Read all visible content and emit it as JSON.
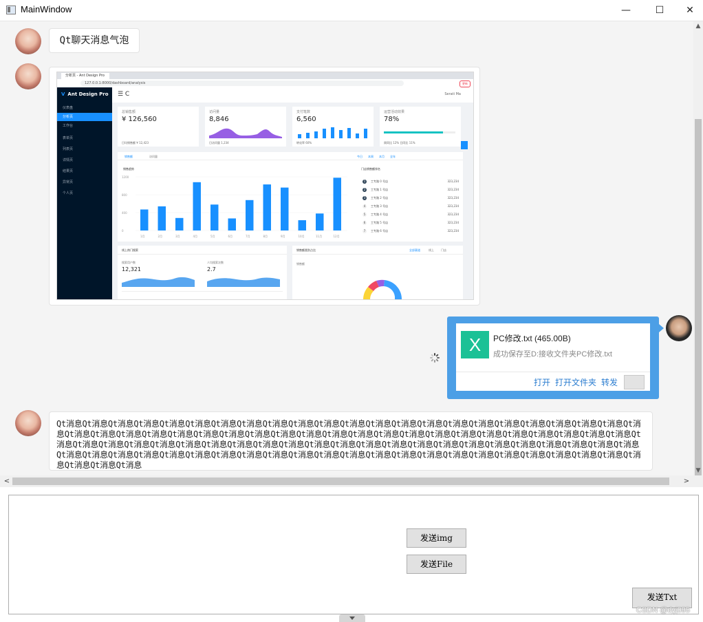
{
  "window": {
    "title": "MainWindow",
    "min": "—",
    "max": "☐",
    "close": "✕"
  },
  "messages": {
    "first_text": "Qt聊天消息气泡",
    "long_text": "Qt消息Qt消息Qt消息Qt消息Qt消息Qt消息Qt消息Qt消息Qt消息Qt消息Qt消息Qt消息Qt消息Qt消息Qt消息Qt消息Qt消息Qt消息Qt消息Qt消息Qt消息Qt消息Qt消息Qt消息Qt消息Qt消息Qt消息Qt消息Qt消息Qt消息Qt消息Qt消息Qt消息Qt消息Qt消息Qt消息Qt消息Qt消息Qt消息Qt消息Qt消息Qt消息Qt消息Qt消息Qt消息Qt消息Qt消息Qt消息Qt消息Qt消息Qt消息Qt消息Qt消息Qt消息Qt消息Qt消息Qt消息Qt消息Qt消息Qt消息Qt消息Qt消息Qt消息Qt消息Qt消息Qt消息Qt消息Qt消息Qt消息Qt消息Qt消息Qt消息Qt消息Qt消息Qt消息Qt消息Qt消息Qt消息Qt消息Qt消息Qt消息Qt消息Qt消息Qt消息Qt消息Qt消息Qt消息Qt消息Qt消息Qt消息Qt消息Qt消息Qt消息Qt消息"
  },
  "file_message": {
    "icon_letter": "X",
    "name": "PC修改.txt (465.00B)",
    "status": "成功保存至D:接收文件夹PC修改.txt",
    "open": "打开",
    "open_folder": "打开文件夹",
    "forward": "转发"
  },
  "screenshot": {
    "tab": "分析页 - Ant Design Pro",
    "url": "127.0.0.1:8000/dashboard/analysis",
    "ext": "更新",
    "logo": "Ant Design Pro",
    "user": "Serati Ma",
    "menu_icon": "☰  C",
    "sider_items": [
      "仪表盘",
      "分析页",
      "工作台",
      "表单页",
      "列表页",
      "详情页",
      "结果页",
      "异常页",
      "个人页"
    ],
    "cards": [
      {
        "label": "总销售额",
        "value": "¥ 126,560",
        "foot": "日均销售额 ¥ 12,423"
      },
      {
        "label": "访问量",
        "value": "8,846",
        "foot": "日访问量 1,234"
      },
      {
        "label": "支付笔数",
        "value": "6,560",
        "foot": "转化率 60%"
      },
      {
        "label": "运营活动效果",
        "value": "78%",
        "foot": "周同比 12%  日同比 11%"
      }
    ],
    "tab_sales": "销售额",
    "tab_visits": "访问量",
    "range": [
      "今日",
      "本周",
      "本月",
      "全年"
    ],
    "chart_title": "销售趋势",
    "rank_title": "门店销售额排名",
    "rank": [
      "工专路 0 号店",
      "工专路 1 号店",
      "工专路 2 号店",
      "工专路 3 号店",
      "工专路 4 号店",
      "工专路 5 号店",
      "工专路 6 号店"
    ],
    "rank_value": "323,234",
    "search_title": "线上热门搜索",
    "search_users": "搜索用户数",
    "search_users_value": "12,321",
    "per_capita": "人均搜索次数",
    "per_capita_value": "2.7",
    "proportion_title": "销售额类别占比",
    "proportion_sub": "销售额",
    "proportion_tabs": [
      "全部渠道",
      "线上",
      "门店"
    ]
  },
  "chart_data": {
    "type": "bar",
    "categories": [
      "1月",
      "2月",
      "3月",
      "4月",
      "5月",
      "6月",
      "7月",
      "8月",
      "9月",
      "10月",
      "11月",
      "12月"
    ],
    "values": [
      470,
      540,
      280,
      1080,
      580,
      270,
      680,
      1030,
      960,
      230,
      380,
      1180
    ],
    "ylim": [
      0,
      1200
    ],
    "yticks": [
      "1200",
      "800",
      "400",
      "0"
    ]
  },
  "buttons": {
    "send_img": "发送img",
    "send_file": "发送File",
    "send_txt": "发送Txt"
  },
  "watermark": "CSDN @dyj095",
  "scroll": {
    "left": "<",
    "right": ">",
    "up": "▲",
    "down": "▼"
  }
}
